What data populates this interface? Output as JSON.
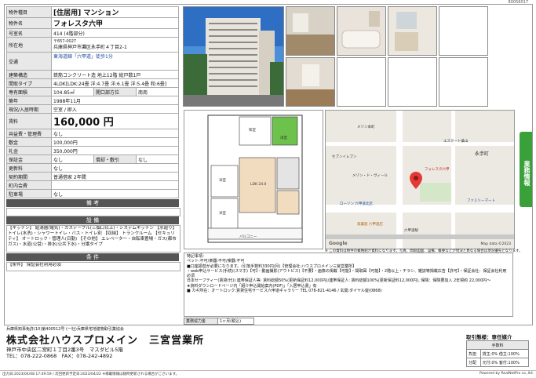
{
  "doc_id": "80056017",
  "spec": {
    "type_label": "物件種目",
    "type_value": "[住居用] マンション",
    "name_label": "物件名",
    "name_value": "フォレスタ六甲",
    "room_label": "号室名",
    "room_value": "414 (4階部分)",
    "addr_label": "所在地",
    "postal": "〒657-0027",
    "addr_value": "兵庫県神戸市灘区永手町４丁目2-1",
    "access_label": "交通",
    "access_value": "東海道線「六甲道」徒歩1分",
    "struct_label": "建築構造",
    "struct_value": "鉄筋コンクリート造 地上12階 総戸数1戸",
    "layout_label": "間取タイプ",
    "layout_value": "4LDK[LDK:24畳 洋:4.7畳 洋:6.1畳 洋:5.4畳 和:6畳]",
    "area_label": "専有面積",
    "area_value": "104.85㎡",
    "dir_label": "開口部方位",
    "dir_value": "南南",
    "built_label": "築年",
    "built_value": "1988年11月",
    "status_label": "現況/入居時期",
    "status_value": "空室 / 即入",
    "rent_label": "賃料",
    "rent_value": "160,000 円",
    "common_label": "共益費・管理費",
    "common_value": "なし",
    "deposit_label": "敷金",
    "deposit_value": "100,000円",
    "key_label": "礼金",
    "key_value": "350,000円",
    "guar_label": "保証金",
    "guar_value": "なし",
    "amort_label": "償却・敷引",
    "amort_value": "なし",
    "renew_label": "更新料",
    "renew_value": "なし",
    "contract_label": "契約期間",
    "contract_value": "普通借家 2年間",
    "assoc_label": "町内会費",
    "assoc_value": "",
    "parking_label": "駐車場",
    "parking_value": "なし"
  },
  "remarks_head": "備 考",
  "equip_head": "設 備",
  "equip_text": "【キッチン】 給湯器(電気)・ガステーブル(三個口以上)・システムキッチン 【水廻り】 トイレ(水洗)・シャワートイレ・バス・トイレ別 【収納】 トランクルーム 【セキュリティ】 オートロック・管理人(日勤) 【その他】 エレベーター・自転車置場・ガス(都市ガス)・水道(公営)・排水(公共下水)・分譲タイプ",
  "cond_head": "条 件",
  "cond_text": "【条件】 保証会社利用必須",
  "side_tab": "業務情報",
  "map": {
    "labels": [
      "メゾン本町",
      "エスタート桑山",
      "永手町",
      "セブンイレブン",
      "ローソン 六甲道北店",
      "ファミリーマート",
      "六甲道駅",
      "鳥貴族 六甲道店",
      "メゾン・ド・ヴィール",
      "フォレスタ六甲"
    ],
    "attribution": "Map data ©2023",
    "google": "Google"
  },
  "map_note": "※ この資料は物件の概略紹介資料になります。写真、間取図面、設備、概要などが現況と異なる場合は現況優先となります。",
  "notes": {
    "title": "特記事項：",
    "lines": [
      "ペット:不可/楽器:不可/楽器:不可",
      "■口座振替が必要になります。(引落手数料330円/月)【管理会社:ハウスプロメイン三宮営業所】",
      "・web申込サービス(手続)(スマホ)【可】・動画撮影(アウトピス)【不要】・画像の掲載【可能】・間取図【可能】・2階以上・チラシ、雑誌等掲載広告【許可】・保証会社：保証会社利用必須",
      "日本セーフティー(賃貸(代)) 連帯保証人等: 賃料総額50%(更新保証料12,000円)/連帯保証人: 賃料総額100%(更新保証料12,000円), 保険：保険要加入 2年契約 22,000円～",
      "★資料ダウンロードページ内「紹介申込開始案内(PDF)」「入居申込書」有",
      "■ カギ所在：オートロック:賃貸住宅サービス六甲道ギャラリー TEL 078-821-4146 / 玄関:ダイヤル錠(0868)"
    ]
  },
  "fee_label": "業務協力金",
  "fee_value": "1ヶ月(税込)",
  "company": {
    "license": "兵庫県知事免許(10)第400512号 (一社)兵庫県宅地建物取引業協会",
    "name": "株式会社ハウスプロメイン　三宮営業所",
    "addr": "神戸市中央区二宮町１丁目2番3号　マスダビル5階",
    "tel": "TEL：078-222-0868　FAX：078-242-4892"
  },
  "deal": {
    "title": "取引態様：専任媒介",
    "fee_head": "手数料",
    "row1_label": "負担",
    "row1_value": "貸主:0% 借主:100%",
    "row2_label": "分配",
    "row2_value": "元付:0% 客付:100%"
  },
  "footer": {
    "left": "出力日:2023/04/08 17:49:59 / 次回更新予定日:2023/04/22 ※掲載情報は随時更新される場合がございます。",
    "right": "Powered by RealNetPro co.,ltd."
  },
  "floorplan": {
    "rooms": [
      "洋室",
      "LDK 24.0",
      "和室",
      "洋室",
      "洋室",
      "バルコニー"
    ],
    "highlight_color": "#6cc24a"
  },
  "colors": {
    "accent_green": "#3aa13a",
    "head_gray": "#555555"
  }
}
